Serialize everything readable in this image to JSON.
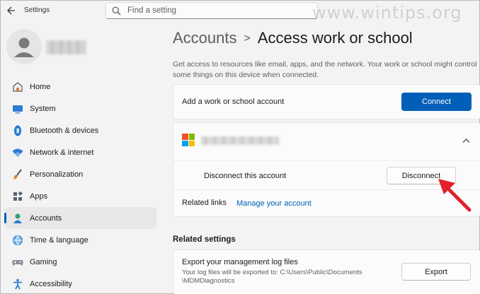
{
  "app": {
    "title": "Settings"
  },
  "search": {
    "placeholder": "Find a setting"
  },
  "watermark": "www.wintips.org",
  "sidebar": {
    "items": [
      {
        "label": "Home",
        "icon": "home-icon"
      },
      {
        "label": "System",
        "icon": "system-icon"
      },
      {
        "label": "Bluetooth & devices",
        "icon": "bluetooth-icon"
      },
      {
        "label": "Network & internet",
        "icon": "wifi-icon"
      },
      {
        "label": "Personalization",
        "icon": "brush-icon"
      },
      {
        "label": "Apps",
        "icon": "apps-icon"
      },
      {
        "label": "Accounts",
        "icon": "accounts-icon",
        "selected": true
      },
      {
        "label": "Time & language",
        "icon": "globe-icon"
      },
      {
        "label": "Gaming",
        "icon": "gamepad-icon"
      },
      {
        "label": "Accessibility",
        "icon": "accessibility-icon"
      }
    ]
  },
  "breadcrumb": {
    "parent": "Accounts",
    "separator": ">",
    "current": "Access work or school"
  },
  "main": {
    "description": "Get access to resources like email, apps, and the network. Your work or school might control some things on this device when connected.",
    "add_account": {
      "label": "Add a work or school account",
      "button": "Connect"
    },
    "account": {
      "disconnect_label": "Disconnect this account",
      "disconnect_button": "Disconnect",
      "related_links_label": "Related links",
      "manage_link": "Manage your account"
    },
    "related_settings": {
      "title": "Related settings",
      "export_title": "Export your management log files",
      "export_desc_line1": "Your log files will be exported to: C:\\Users\\Public\\Documents",
      "export_desc_line2": "\\MDMDiagnostics",
      "export_button": "Export"
    }
  },
  "colors": {
    "accent": "#005fb8",
    "arrow": "#e2212a",
    "background": "#f3f3f3",
    "card": "#fbfbfb"
  }
}
